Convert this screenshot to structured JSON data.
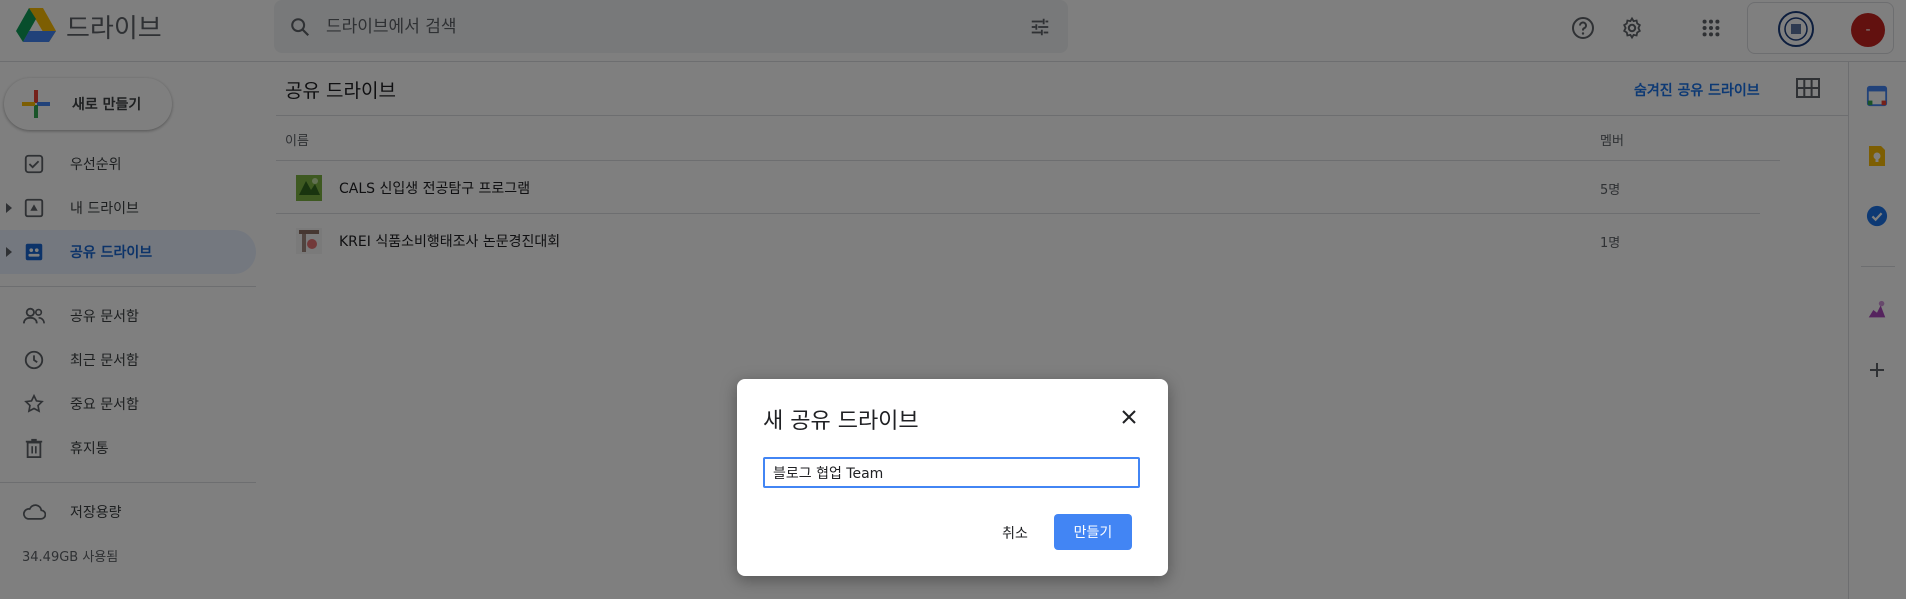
{
  "app": {
    "title": "드라이브",
    "logo_icon": "google-drive-icon"
  },
  "search": {
    "placeholder": "드라이브에서 검색",
    "icon": "search-icon",
    "filter_icon": "tune-icon"
  },
  "header_icons": [
    "help-icon",
    "settings-icon",
    "apps-grid-icon"
  ],
  "account": {
    "avatar_initial": "-",
    "avatar_color": "#c5221f"
  },
  "sidebar": {
    "new_button_label": "새로 만들기",
    "items": [
      {
        "label": "우선순위",
        "icon": "priority-check-icon",
        "active": false
      },
      {
        "label": "내 드라이브",
        "icon": "my-drive-icon",
        "active": false,
        "expandable": true
      },
      {
        "label": "공유 드라이브",
        "icon": "shared-drive-icon",
        "active": true,
        "expandable": true
      },
      {
        "label": "공유 문서함",
        "icon": "people-icon",
        "active": false
      },
      {
        "label": "최근 문서함",
        "icon": "clock-icon",
        "active": false
      },
      {
        "label": "중요 문서함",
        "icon": "star-icon",
        "active": false
      },
      {
        "label": "휴지통",
        "icon": "trash-icon",
        "active": false
      },
      {
        "label": "저장용량",
        "icon": "cloud-icon",
        "active": false
      }
    ],
    "storage_used": "34.49GB 사용됨"
  },
  "main": {
    "title": "공유 드라이브",
    "hidden_link": "숨겨진 공유 드라이브",
    "view_icon": "grid-view-icon",
    "columns": {
      "name": "이름",
      "members": "멤버"
    },
    "rows": [
      {
        "name": "CALS 신입생 전공탐구 프로그램",
        "members": "5명"
      },
      {
        "name": "KREI 식품소비행태조사 논문경진대회",
        "members": "1명"
      }
    ]
  },
  "side_panel_icons": [
    "calendar-icon",
    "keep-icon",
    "tasks-icon",
    "addon-icon",
    "add-icon"
  ],
  "dialog": {
    "title": "새 공유 드라이브",
    "input_value": "블로그 협업 Team",
    "cancel_label": "취소",
    "create_label": "만들기",
    "accent": "#4285f4"
  }
}
